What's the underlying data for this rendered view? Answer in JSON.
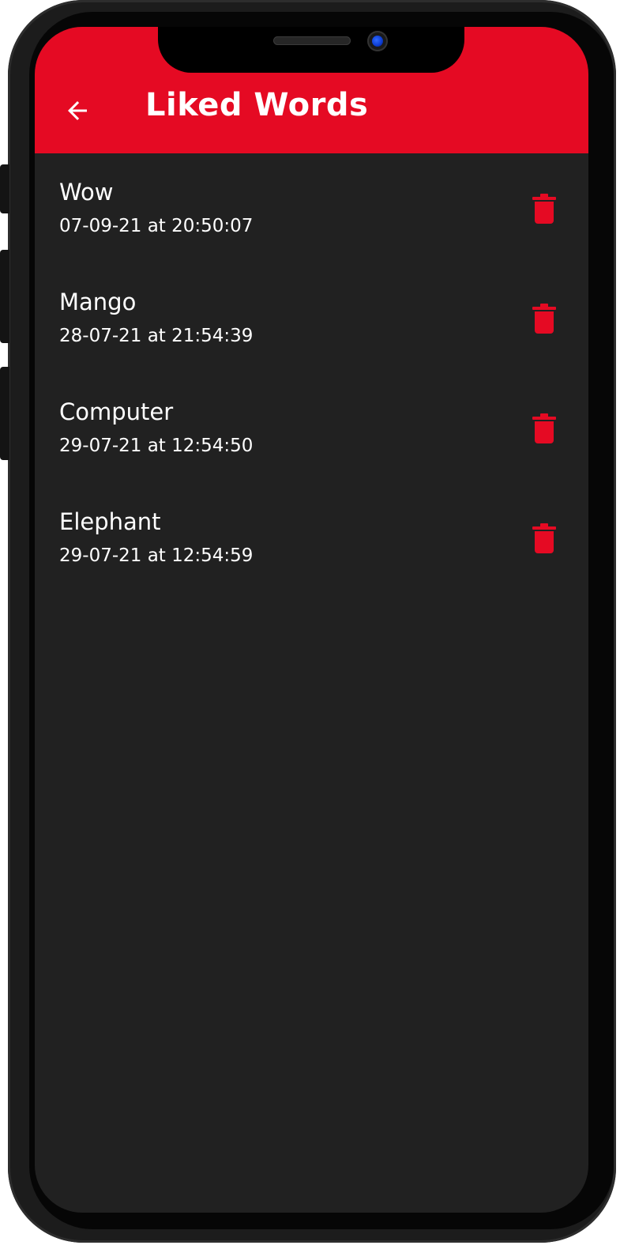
{
  "app_bar": {
    "title": "Liked Words",
    "back_icon": "arrow-left-icon",
    "color": "#e50a23"
  },
  "theme": {
    "background": "#212121",
    "text": "#ffffff",
    "accent": "#e50a23"
  },
  "words": [
    {
      "word": "Wow",
      "liked_at": "07-09-21 at 20:50:07",
      "delete_icon": "trash-icon"
    },
    {
      "word": "Mango",
      "liked_at": "28-07-21 at 21:54:39",
      "delete_icon": "trash-icon"
    },
    {
      "word": "Computer",
      "liked_at": "29-07-21 at 12:54:50",
      "delete_icon": "trash-icon"
    },
    {
      "word": "Elephant",
      "liked_at": "29-07-21 at 12:54:59",
      "delete_icon": "trash-icon"
    }
  ]
}
